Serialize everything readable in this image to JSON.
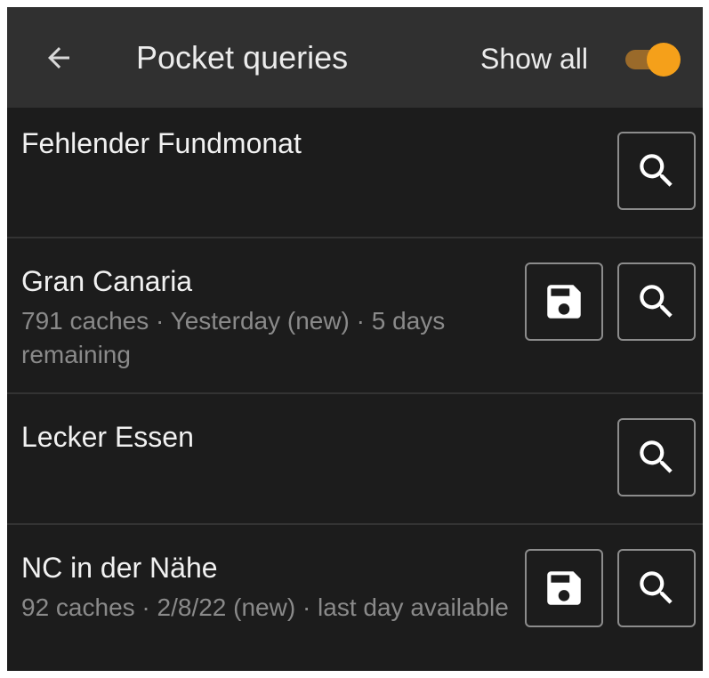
{
  "header": {
    "back_icon": "arrow-left-icon",
    "title": "Pocket queries",
    "show_all_label": "Show all",
    "show_all_enabled": true,
    "toggle_color": "#f5a01a"
  },
  "queries": [
    {
      "name": "Fehlender Fundmonat",
      "details": "",
      "has_download": false
    },
    {
      "name": "Gran Canaria",
      "details": "791 caches · Yesterday (new) · 5 days remaining",
      "has_download": true
    },
    {
      "name": "Lecker Essen",
      "details": "",
      "has_download": false
    },
    {
      "name": "NC in der Nähe",
      "details": "92 caches · 2/8/22 (new) · last day available",
      "has_download": true
    }
  ],
  "icons": {
    "download": "save-icon",
    "search": "search-icon"
  }
}
